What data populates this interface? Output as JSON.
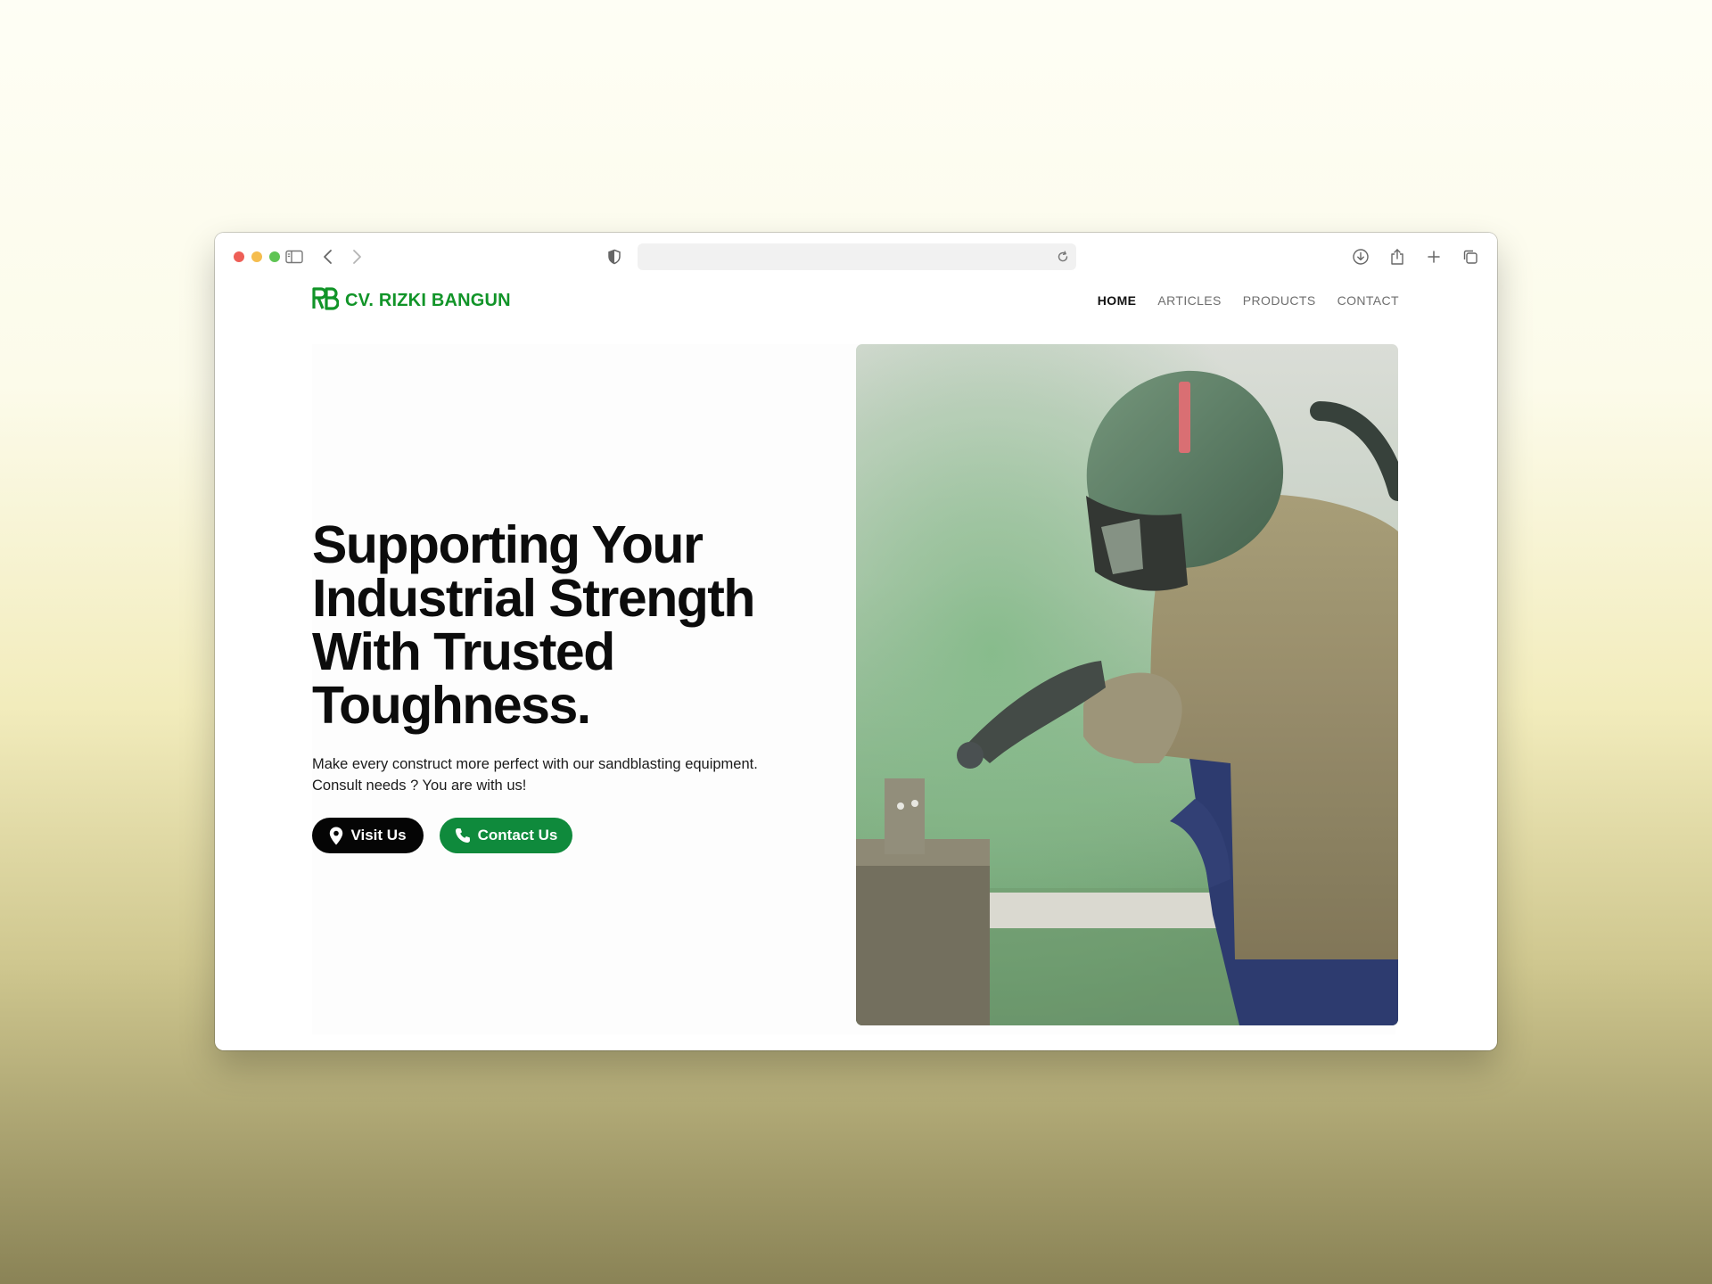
{
  "browser": {
    "url": "",
    "icons": [
      "sidebar-icon",
      "back-icon",
      "forward-icon",
      "shield-icon",
      "reload-icon",
      "download-icon",
      "share-icon",
      "new-tab-icon",
      "tabs-overview-icon"
    ]
  },
  "brand": {
    "name": "CV. RIZKI BANGUN",
    "logo_text": "RB",
    "color": "#119428"
  },
  "nav": {
    "items": [
      {
        "label": "HOME",
        "active": true
      },
      {
        "label": "ARTICLES",
        "active": false
      },
      {
        "label": "PRODUCTS",
        "active": false
      },
      {
        "label": "CONTACT",
        "active": false
      }
    ]
  },
  "hero": {
    "title_lines": [
      "Supporting Your",
      "Industrial Strength",
      "With Trusted",
      "Toughness."
    ],
    "subtitle": "Make every construct more perfect with our sandblasting equipment. Consult needs ? You are with us!",
    "buttons": {
      "visit": {
        "label": "Visit Us",
        "icon": "map-pin-icon",
        "color": "#050505"
      },
      "contact": {
        "label": "Contact Us",
        "icon": "phone-icon",
        "color": "#0f8a3c"
      }
    },
    "image": {
      "subject": "sandblasting-worker-photo"
    }
  }
}
